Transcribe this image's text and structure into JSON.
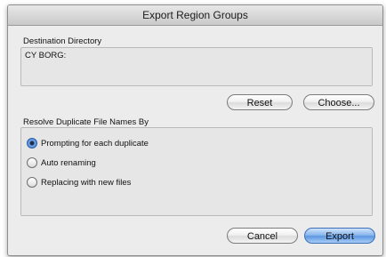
{
  "window": {
    "title": "Export Region Groups"
  },
  "destination": {
    "label": "Destination Directory",
    "value": "CY BORG:"
  },
  "buttons": {
    "reset": "Reset",
    "choose": "Choose...",
    "cancel": "Cancel",
    "export": "Export"
  },
  "duplicates": {
    "label": "Resolve Duplicate File Names By",
    "options": [
      {
        "label": "Prompting for each duplicate",
        "selected": true
      },
      {
        "label": "Auto renaming",
        "selected": false
      },
      {
        "label": "Replacing with new files",
        "selected": false
      }
    ]
  },
  "colors": {
    "accent": "#5d97e2",
    "dialog_background": "#ececec"
  }
}
